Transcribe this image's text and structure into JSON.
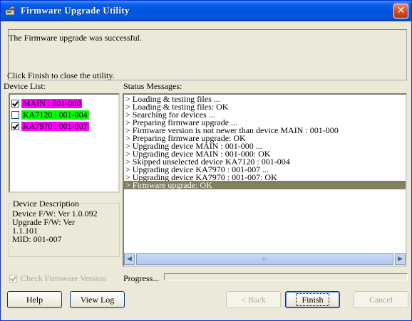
{
  "window": {
    "title": "Firmware Upgrade Utility",
    "close_glyph": "✕"
  },
  "message": {
    "result": "The Firmware upgrade was successful.",
    "hint": "Click Finish to close the utility."
  },
  "device_list": {
    "label": "Device List:",
    "items": [
      {
        "label": "MAIN : 001-000",
        "checked": true,
        "color": "#ff00ff"
      },
      {
        "label": "KA7120 : 001-004",
        "checked": false,
        "color": "#00ff00"
      },
      {
        "label": "KA7970 : 001-007",
        "checked": true,
        "color": "#ff00ff"
      }
    ]
  },
  "device_description": {
    "title": "Device Description",
    "lines": [
      "Device F/W: Ver 1.0.092",
      "Upgrade F/W: Ver",
      "1.1.101",
      "MID: 001-007"
    ]
  },
  "status": {
    "label": "Status Messages:",
    "lines": [
      "> Loading & testing files ...",
      "> Loading & testing files: OK",
      "> Searching for devices ...",
      "> Preparing firmware upgrade ...",
      "> Firmware version is not newer than device MAIN : 001-000",
      "> Preparing firmware upgrade: OK",
      "> Upgrading device MAIN : 001-000 ...",
      "> Upgrading device MAIN : 001-000: OK",
      "> Skipped unselected device KA7120 : 001-004",
      "> Upgrading device KA7970 : 001-007 ...",
      "> Upgrading device KA7970 : 001-007: OK",
      "> Firmware upgrade: OK"
    ],
    "selected_index": 11,
    "scroll_left_glyph": "◀",
    "scroll_right_glyph": "▶",
    "thumb_grip": "III"
  },
  "options": {
    "check_firmware_version": "Check Firmware Version",
    "check_firmware_version_checked": true
  },
  "progress": {
    "label": "Progress...",
    "value": 0
  },
  "buttons": {
    "help": "Help",
    "view_log": "View Log",
    "back": "< Back",
    "finish": "Finish",
    "cancel": "Cancel"
  },
  "icons": {
    "app": "firmware-upgrade-app-icon",
    "close": "close-icon"
  }
}
